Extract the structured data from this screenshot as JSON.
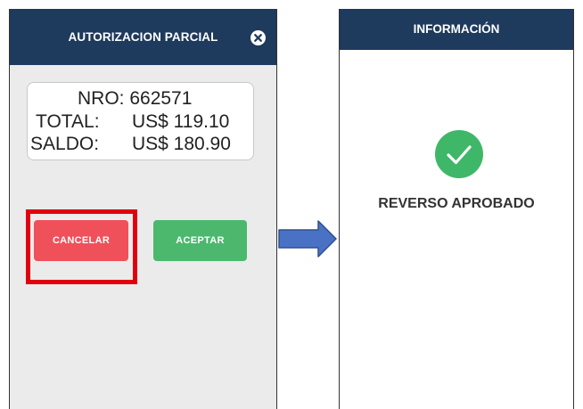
{
  "left_screen": {
    "title": "AUTORIZACION PARCIAL",
    "close_icon": "close-icon",
    "details": {
      "nro": "NRO: 662571",
      "total_label": "TOTAL:",
      "total_value": "US$ 119.10",
      "saldo_label": "SALDO:",
      "saldo_value": "US$ 180.90"
    },
    "buttons": {
      "cancel_label": "CANCELAR",
      "accept_label": "ACEPTAR"
    }
  },
  "right_screen": {
    "title": "INFORMACIÓN",
    "status_icon": "check-circle-icon",
    "status_message": "REVERSO APROBADO"
  },
  "colors": {
    "header": "#1e3a5c",
    "cancel": "#f0505a",
    "accept": "#4bb86e",
    "highlight": "#e0000f",
    "success": "#3fb769",
    "arrow": "#4a72c4"
  }
}
